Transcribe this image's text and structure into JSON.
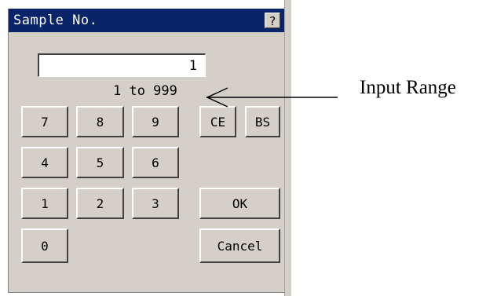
{
  "dialog": {
    "title": "Sample No.",
    "help_label": "?",
    "input_value": "1",
    "range_text": "1 to 999"
  },
  "keypad": {
    "k7": "7",
    "k8": "8",
    "k9": "9",
    "k4": "4",
    "k5": "5",
    "k6": "6",
    "k1": "1",
    "k2": "2",
    "k3": "3",
    "k0": "0",
    "ce": "CE",
    "bs": "BS",
    "ok": "OK",
    "cancel": "Cancel"
  },
  "annotation": {
    "label": "Input Range"
  },
  "colors": {
    "titlebar": "#0a246a",
    "face": "#d4d0c8"
  }
}
